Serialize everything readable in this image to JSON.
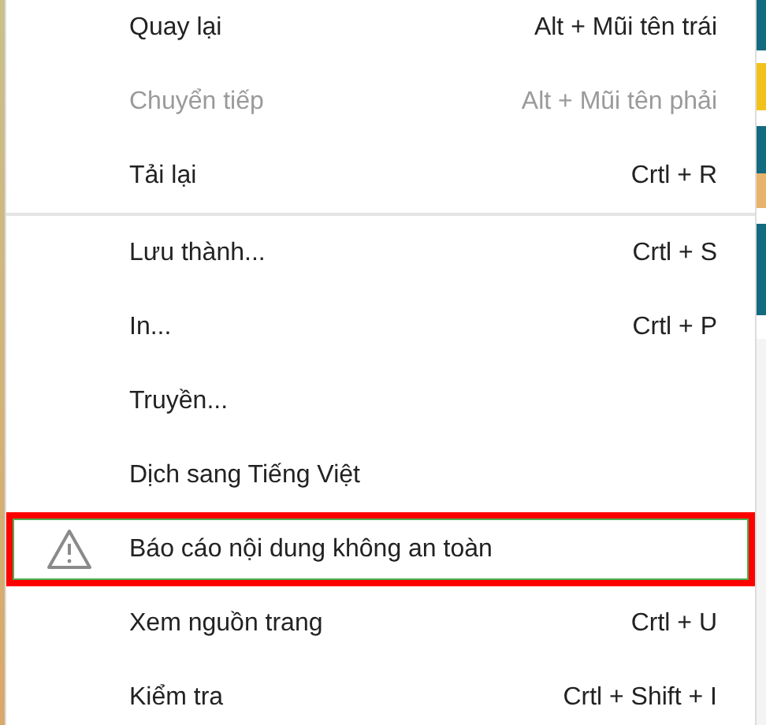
{
  "context_menu": {
    "groups": [
      {
        "items": [
          {
            "label": "Quay lại",
            "shortcut": "Alt + Mũi tên trái",
            "disabled": false,
            "highlighted": false
          },
          {
            "label": "Chuyển tiếp",
            "shortcut": "Alt + Mũi tên phải",
            "disabled": true,
            "highlighted": false
          },
          {
            "label": "Tải lại",
            "shortcut": "Crtl + R",
            "disabled": false,
            "highlighted": false
          }
        ]
      },
      {
        "items": [
          {
            "label": "Lưu thành...",
            "shortcut": "Crtl + S",
            "disabled": false,
            "highlighted": false
          },
          {
            "label": "In...",
            "shortcut": "Crtl + P",
            "disabled": false,
            "highlighted": false
          },
          {
            "label": "Truyền...",
            "disabled": false,
            "highlighted": false
          },
          {
            "label": "Dịch sang Tiếng Việt",
            "disabled": false,
            "highlighted": false
          },
          {
            "label": "Báo cáo nội dung không an toàn",
            "kind": "warning",
            "disabled": false,
            "highlighted": true
          },
          {
            "label": "Xem nguồn trang",
            "shortcut": "Crtl + U",
            "disabled": false,
            "highlighted": false
          },
          {
            "label": "Kiểm tra",
            "shortcut": "Crtl + Shift + I",
            "disabled": false,
            "highlighted": false
          }
        ]
      }
    ]
  }
}
